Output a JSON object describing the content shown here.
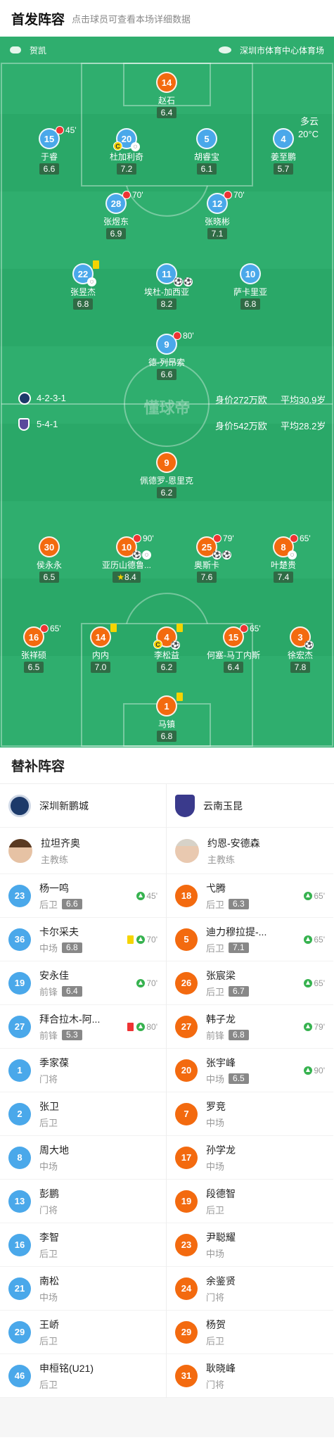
{
  "header": {
    "title": "首发阵容",
    "subtitle": "点击球员可查看本场详细数据"
  },
  "match_info": {
    "referee": "贺凯",
    "venue": "深圳市体育中心体育场",
    "weather": "多云",
    "temperature": "20°C"
  },
  "teams": {
    "home": {
      "name": "深圳新鹏城",
      "formation": "4-2-3-1",
      "value": "身价272万欧",
      "avg_age": "平均30.9岁",
      "color": "#4aa8ea"
    },
    "away": {
      "name": "云南玉昆",
      "formation": "5-4-1",
      "value": "身价542万欧",
      "avg_age": "平均28.2岁",
      "color": "#f36a0f"
    }
  },
  "watermark": "懂球帝",
  "home_players": [
    {
      "num": "14",
      "name": "赵石",
      "rating": "6.4",
      "team": "away"
    },
    {
      "num": "15",
      "name": "于睿",
      "rating": "6.6",
      "sub": "45'"
    },
    {
      "num": "20",
      "name": "杜加利奇",
      "rating": "7.2"
    },
    {
      "num": "5",
      "name": "胡睿宝",
      "rating": "6.1"
    },
    {
      "num": "4",
      "name": "姜至鹏",
      "rating": "5.7"
    },
    {
      "num": "28",
      "name": "张煜东",
      "rating": "6.9",
      "sub": "70'"
    },
    {
      "num": "12",
      "name": "张晓彬",
      "rating": "7.1",
      "sub": "70'"
    },
    {
      "num": "22",
      "name": "张昱杰",
      "rating": "6.8"
    },
    {
      "num": "11",
      "name": "埃杜-加西亚",
      "rating": "8.2"
    },
    {
      "num": "10",
      "name": "萨卡里亚",
      "rating": "6.8"
    },
    {
      "num": "9",
      "name": "德-列昂索",
      "rating": "6.6",
      "sub": "80'"
    }
  ],
  "away_players": [
    {
      "num": "9",
      "name": "佩德罗-恩里克",
      "rating": "6.2"
    },
    {
      "num": "30",
      "name": "侯永永",
      "rating": "6.5"
    },
    {
      "num": "10",
      "name": "亚历山德鲁...",
      "rating": "8.4",
      "sub": "90'"
    },
    {
      "num": "25",
      "name": "奥斯卡",
      "rating": "7.6",
      "sub": "79'"
    },
    {
      "num": "8",
      "name": "叶楚贵",
      "rating": "7.4",
      "sub": "65'"
    },
    {
      "num": "16",
      "name": "张祥硕",
      "rating": "6.5",
      "sub": "65'"
    },
    {
      "num": "14",
      "name": "内内",
      "rating": "7.0"
    },
    {
      "num": "4",
      "name": "李松益",
      "rating": "6.2"
    },
    {
      "num": "15",
      "name": "何塞-马丁内斯",
      "rating": "6.4",
      "sub": "65'"
    },
    {
      "num": "3",
      "name": "徐宏杰",
      "rating": "7.8"
    },
    {
      "num": "1",
      "name": "马镇",
      "rating": "6.8"
    }
  ],
  "subs": {
    "title": "替补阵容",
    "home": {
      "coach": {
        "name": "拉坦齐奥",
        "role": "主教练"
      },
      "players": [
        {
          "num": "23",
          "name": "杨一鸣",
          "pos": "后卫",
          "rating": "6.6",
          "on": "45'"
        },
        {
          "num": "36",
          "name": "卡尔采夫",
          "pos": "中场",
          "rating": "6.8",
          "on": "70'",
          "card": "yellow"
        },
        {
          "num": "19",
          "name": "安永佳",
          "pos": "前锋",
          "rating": "6.4",
          "on": "70'"
        },
        {
          "num": "27",
          "name": "拜合拉木-阿...",
          "pos": "前锋",
          "rating": "5.3",
          "on": "80'",
          "card": "red"
        },
        {
          "num": "1",
          "name": "季家葆",
          "pos": "门将"
        },
        {
          "num": "2",
          "name": "张卫",
          "pos": "后卫"
        },
        {
          "num": "8",
          "name": "周大地",
          "pos": "中场"
        },
        {
          "num": "13",
          "name": "彭鹏",
          "pos": "门将"
        },
        {
          "num": "16",
          "name": "李智",
          "pos": "后卫"
        },
        {
          "num": "21",
          "name": "南松",
          "pos": "中场"
        },
        {
          "num": "29",
          "name": "王峤",
          "pos": "后卫"
        },
        {
          "num": "46",
          "name": "申桓铭(U21)",
          "pos": "后卫"
        }
      ]
    },
    "away": {
      "coach": {
        "name": "约恩-安德森",
        "role": "主教练"
      },
      "players": [
        {
          "num": "18",
          "name": "弋腾",
          "pos": "后卫",
          "rating": "6.3",
          "on": "65'"
        },
        {
          "num": "5",
          "name": "迪力穆拉提-...",
          "pos": "后卫",
          "rating": "7.1",
          "on": "65'"
        },
        {
          "num": "26",
          "name": "张宸梁",
          "pos": "后卫",
          "rating": "6.7",
          "on": "65'"
        },
        {
          "num": "27",
          "name": "韩子龙",
          "pos": "前锋",
          "rating": "6.8",
          "on": "79'"
        },
        {
          "num": "20",
          "name": "张宇峰",
          "pos": "中场",
          "rating": "6.5",
          "on": "90'"
        },
        {
          "num": "7",
          "name": "罗竞",
          "pos": "中场"
        },
        {
          "num": "17",
          "name": "孙学龙",
          "pos": "中场"
        },
        {
          "num": "19",
          "name": "段德智",
          "pos": "后卫"
        },
        {
          "num": "23",
          "name": "尹聪耀",
          "pos": "中场"
        },
        {
          "num": "24",
          "name": "余鉴贤",
          "pos": "门将"
        },
        {
          "num": "29",
          "name": "杨贺",
          "pos": "后卫"
        },
        {
          "num": "31",
          "name": "耿晓峰",
          "pos": "门将"
        }
      ]
    }
  }
}
